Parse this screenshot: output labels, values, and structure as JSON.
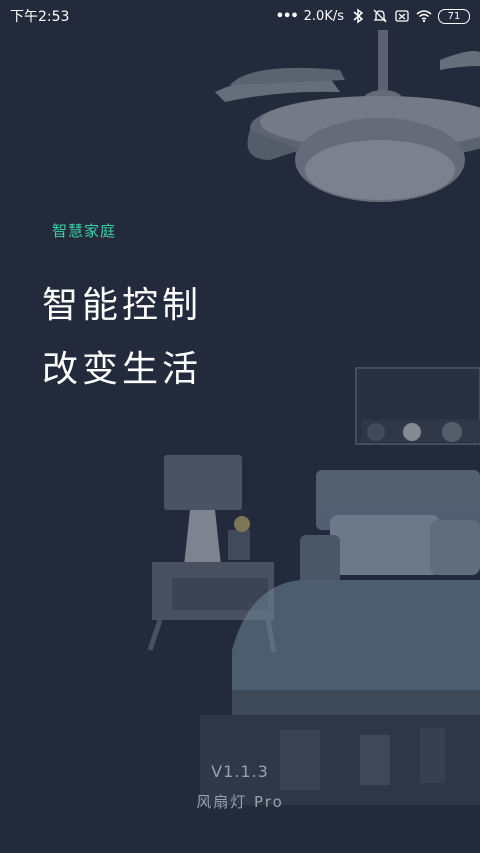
{
  "status_bar": {
    "time": "下午2:53",
    "network_speed": "2.0K/s",
    "battery": "71",
    "icons": [
      "more-dots-icon",
      "bluetooth-icon",
      "mute-bell-icon",
      "sim-off-icon",
      "wifi-icon",
      "battery-icon"
    ]
  },
  "splash": {
    "app_label": "智慧家庭",
    "headline_line1": "智能控制",
    "headline_line2": "改变生活",
    "version": "V1.1.3",
    "app_name": "风扇灯 Pro"
  },
  "colors": {
    "background": "#222a3b",
    "accent": "#3fcfa6",
    "footer_text": "#9aa1ad"
  }
}
